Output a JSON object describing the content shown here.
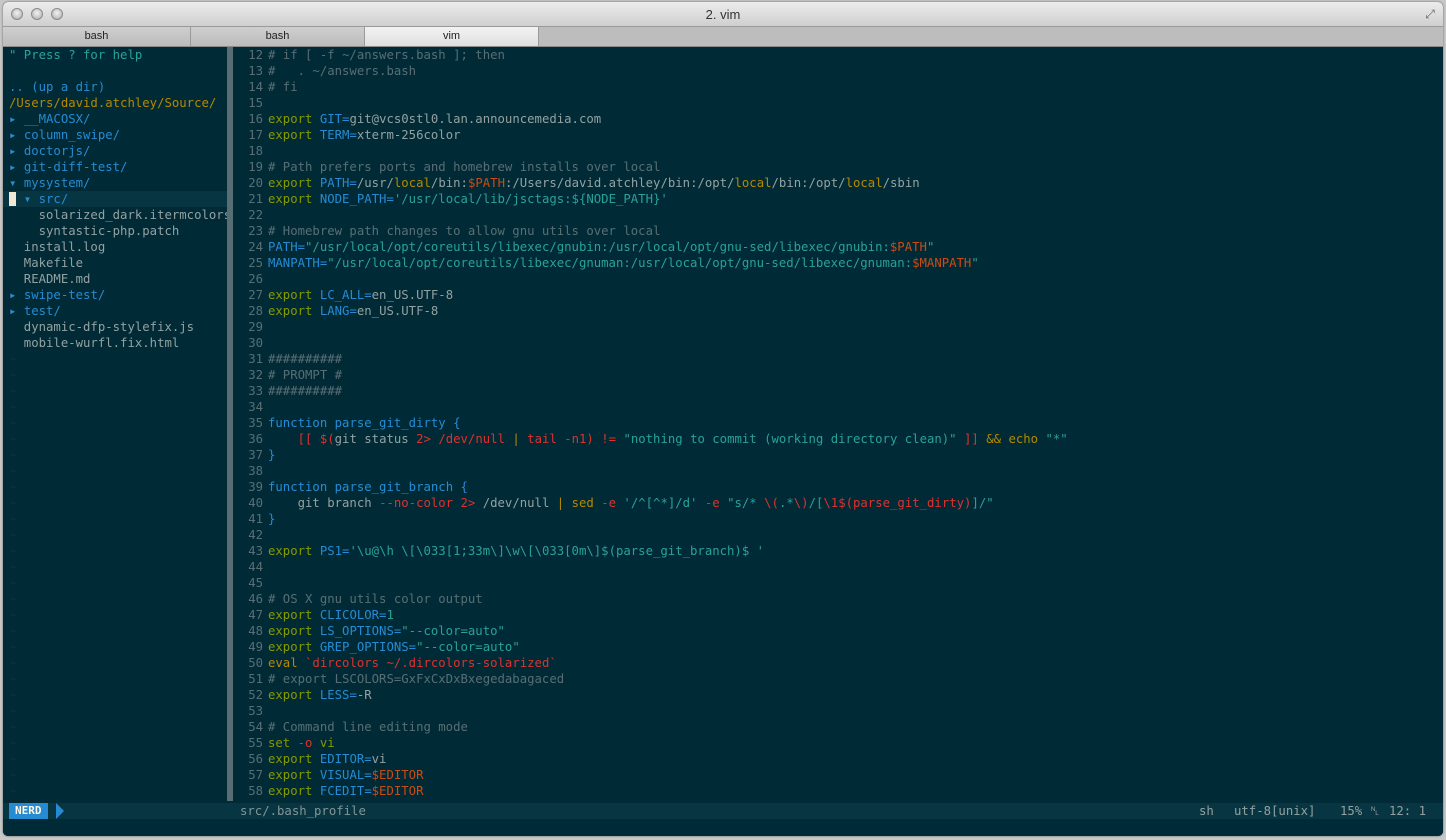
{
  "window": {
    "title": "2. vim"
  },
  "tabs": [
    {
      "label": "bash",
      "active": false
    },
    {
      "label": "bash",
      "active": false
    },
    {
      "label": "vim",
      "active": true
    }
  ],
  "colors": {
    "base03": "#002b36",
    "base02": "#073642",
    "base01": "#586e75",
    "base0": "#839496",
    "base1": "#93a1a1",
    "yellow": "#b58900",
    "orange": "#cb4b16",
    "red": "#dc322f",
    "blue": "#268bd2",
    "cyan": "#2aa198",
    "green": "#859900",
    "violet": "#6c71c4"
  },
  "nerdtree": {
    "lines": [
      [
        {
          "t": "\" Press ? for help",
          "c": "cyan"
        }
      ],
      [
        {
          "t": "",
          "c": "base1"
        }
      ],
      [
        {
          "t": ".. (up a dir)",
          "c": "blue"
        }
      ],
      [
        {
          "t": "/Users/david.atchley/Source/",
          "c": "yellow"
        }
      ],
      [
        {
          "t": "▸ ",
          "c": "blue"
        },
        {
          "t": "__MACOSX/",
          "c": "blue"
        }
      ],
      [
        {
          "t": "▸ ",
          "c": "blue"
        },
        {
          "t": "column_swipe/",
          "c": "blue"
        }
      ],
      [
        {
          "t": "▸ ",
          "c": "blue"
        },
        {
          "t": "doctorjs/",
          "c": "blue"
        }
      ],
      [
        {
          "t": "▸ ",
          "c": "blue"
        },
        {
          "t": "git-diff-test/",
          "c": "blue"
        }
      ],
      [
        {
          "t": "▾ ",
          "c": "blue"
        },
        {
          "t": "mysystem/",
          "c": "blue"
        }
      ],
      [
        {
          "t": "  ▾ ",
          "c": "blue"
        },
        {
          "t": "src/",
          "c": "blue"
        }
      ],
      [
        {
          "t": "    solarized_dark.itermcolors",
          "c": "base1"
        }
      ],
      [
        {
          "t": "    syntastic-php.patch",
          "c": "base1"
        }
      ],
      [
        {
          "t": "  install.log",
          "c": "base1"
        }
      ],
      [
        {
          "t": "  Makefile",
          "c": "base1"
        }
      ],
      [
        {
          "t": "  README.md",
          "c": "base1"
        }
      ],
      [
        {
          "t": "▸ ",
          "c": "blue"
        },
        {
          "t": "swipe-test/",
          "c": "blue"
        }
      ],
      [
        {
          "t": "▸ ",
          "c": "blue"
        },
        {
          "t": "test/",
          "c": "blue"
        }
      ],
      [
        {
          "t": "  dynamic-dfp-stylefix.js",
          "c": "base1"
        }
      ],
      [
        {
          "t": "  mobile-wurfl.fix.html",
          "c": "base1"
        }
      ]
    ],
    "cursor_line": 9,
    "filler": "~"
  },
  "editor": {
    "lines": [
      {
        "n": "12",
        "s": [
          {
            "t": "# if [ -f ~/answers.bash ]; then",
            "c": "base01"
          }
        ]
      },
      {
        "n": "13",
        "s": [
          {
            "t": "#   . ~/answers.bash",
            "c": "base01"
          }
        ]
      },
      {
        "n": "14",
        "s": [
          {
            "t": "# fi",
            "c": "base01"
          }
        ]
      },
      {
        "n": "15",
        "s": []
      },
      {
        "n": "16",
        "s": [
          {
            "t": "export ",
            "c": "green"
          },
          {
            "t": "GIT=",
            "c": "blue"
          },
          {
            "t": "git@vcs0stl0.lan.announcemedia.com",
            "c": "base1"
          }
        ]
      },
      {
        "n": "17",
        "s": [
          {
            "t": "export ",
            "c": "green"
          },
          {
            "t": "TERM=",
            "c": "blue"
          },
          {
            "t": "xterm-256color",
            "c": "base1"
          }
        ]
      },
      {
        "n": "18",
        "s": []
      },
      {
        "n": "19",
        "s": [
          {
            "t": "# Path prefers ports and homebrew installs over local",
            "c": "base01"
          }
        ]
      },
      {
        "n": "20",
        "s": [
          {
            "t": "export ",
            "c": "green"
          },
          {
            "t": "PATH=",
            "c": "blue"
          },
          {
            "t": "/usr/",
            "c": "base1"
          },
          {
            "t": "local",
            "c": "yellow"
          },
          {
            "t": "/bin:",
            "c": "base1"
          },
          {
            "t": "$PATH",
            "c": "orange"
          },
          {
            "t": ":/Users/david.atchley/bin:/opt/",
            "c": "base1"
          },
          {
            "t": "local",
            "c": "yellow"
          },
          {
            "t": "/bin:/opt/",
            "c": "base1"
          },
          {
            "t": "local",
            "c": "yellow"
          },
          {
            "t": "/sbin",
            "c": "base1"
          }
        ]
      },
      {
        "n": "21",
        "s": [
          {
            "t": "export ",
            "c": "green"
          },
          {
            "t": "NODE_PATH=",
            "c": "blue"
          },
          {
            "t": "'/usr/local/lib/jsctags:${NODE_PATH}'",
            "c": "cyan"
          }
        ]
      },
      {
        "n": "22",
        "s": []
      },
      {
        "n": "23",
        "s": [
          {
            "t": "# Homebrew path changes to allow gnu utils over local",
            "c": "base01"
          }
        ]
      },
      {
        "n": "24",
        "s": [
          {
            "t": "PATH=",
            "c": "blue"
          },
          {
            "t": "\"/usr/local/opt/coreutils/libexec/gnubin:/usr/local/opt/gnu-sed/libexec/gnubin:",
            "c": "cyan"
          },
          {
            "t": "$PATH",
            "c": "orange"
          },
          {
            "t": "\"",
            "c": "cyan"
          }
        ]
      },
      {
        "n": "25",
        "s": [
          {
            "t": "MANPATH=",
            "c": "blue"
          },
          {
            "t": "\"/usr/local/opt/coreutils/libexec/gnuman:/usr/local/opt/gnu-sed/libexec/gnuman:",
            "c": "cyan"
          },
          {
            "t": "$MANPATH",
            "c": "orange"
          },
          {
            "t": "\"",
            "c": "cyan"
          }
        ]
      },
      {
        "n": "26",
        "s": []
      },
      {
        "n": "27",
        "s": [
          {
            "t": "export ",
            "c": "green"
          },
          {
            "t": "LC_ALL=",
            "c": "blue"
          },
          {
            "t": "en_US.UTF-8",
            "c": "base1"
          }
        ]
      },
      {
        "n": "28",
        "s": [
          {
            "t": "export ",
            "c": "green"
          },
          {
            "t": "LANG=",
            "c": "blue"
          },
          {
            "t": "en_US.UTF-8",
            "c": "base1"
          }
        ]
      },
      {
        "n": "29",
        "s": []
      },
      {
        "n": "30",
        "s": []
      },
      {
        "n": "31",
        "s": [
          {
            "t": "##########",
            "c": "base01"
          }
        ]
      },
      {
        "n": "32",
        "s": [
          {
            "t": "# PROMPT #",
            "c": "base01"
          }
        ]
      },
      {
        "n": "33",
        "s": [
          {
            "t": "##########",
            "c": "base01"
          }
        ]
      },
      {
        "n": "34",
        "s": []
      },
      {
        "n": "35",
        "s": [
          {
            "t": "function ",
            "c": "blue"
          },
          {
            "t": "parse_git_dirty ",
            "c": "blue"
          },
          {
            "t": "{",
            "c": "blue"
          }
        ]
      },
      {
        "n": "36",
        "s": [
          {
            "t": "    ",
            "c": "base0"
          },
          {
            "t": "[[ ",
            "c": "red"
          },
          {
            "t": "$(",
            "c": "red"
          },
          {
            "t": "git status ",
            "c": "base1"
          },
          {
            "t": "2> ",
            "c": "red"
          },
          {
            "t": "/dev/null ",
            "c": "red"
          },
          {
            "t": "| ",
            "c": "yellow"
          },
          {
            "t": "tail -n1",
            "c": "red"
          },
          {
            "t": ") ",
            "c": "red"
          },
          {
            "t": "!= ",
            "c": "red"
          },
          {
            "t": "\"nothing to commit (working directory clean)\"",
            "c": "cyan"
          },
          {
            "t": " ]] ",
            "c": "red"
          },
          {
            "t": "&& ",
            "c": "yellow"
          },
          {
            "t": "echo ",
            "c": "yellow"
          },
          {
            "t": "\"*\"",
            "c": "cyan"
          }
        ]
      },
      {
        "n": "37",
        "s": [
          {
            "t": "}",
            "c": "blue"
          }
        ]
      },
      {
        "n": "38",
        "s": []
      },
      {
        "n": "39",
        "s": [
          {
            "t": "function ",
            "c": "blue"
          },
          {
            "t": "parse_git_branch ",
            "c": "blue"
          },
          {
            "t": "{",
            "c": "blue"
          }
        ]
      },
      {
        "n": "40",
        "s": [
          {
            "t": "    git branch ",
            "c": "base1"
          },
          {
            "t": "--no-color ",
            "c": "red"
          },
          {
            "t": "2> ",
            "c": "red"
          },
          {
            "t": "/dev/null ",
            "c": "base1"
          },
          {
            "t": "| ",
            "c": "yellow"
          },
          {
            "t": "sed ",
            "c": "yellow"
          },
          {
            "t": "-e ",
            "c": "red"
          },
          {
            "t": "'/^[^*]/d'",
            "c": "cyan"
          },
          {
            "t": " -e ",
            "c": "red"
          },
          {
            "t": "\"s/* ",
            "c": "cyan"
          },
          {
            "t": "\\(",
            "c": "red"
          },
          {
            "t": ".*",
            "c": "cyan"
          },
          {
            "t": "\\)",
            "c": "red"
          },
          {
            "t": "/[",
            "c": "cyan"
          },
          {
            "t": "\\1",
            "c": "red"
          },
          {
            "t": "$(parse_git_dirty)",
            "c": "red"
          },
          {
            "t": "]/\"",
            "c": "cyan"
          }
        ]
      },
      {
        "n": "41",
        "s": [
          {
            "t": "}",
            "c": "blue"
          }
        ]
      },
      {
        "n": "42",
        "s": []
      },
      {
        "n": "43",
        "s": [
          {
            "t": "export ",
            "c": "green"
          },
          {
            "t": "PS1=",
            "c": "blue"
          },
          {
            "t": "'\\u@\\h \\[\\033[1;33m\\]\\w\\[\\033[0m\\]$(parse_git_branch)$ '",
            "c": "cyan"
          }
        ]
      },
      {
        "n": "44",
        "s": []
      },
      {
        "n": "45",
        "s": []
      },
      {
        "n": "46",
        "s": [
          {
            "t": "# OS X gnu utils color output",
            "c": "base01"
          }
        ]
      },
      {
        "n": "47",
        "s": [
          {
            "t": "export ",
            "c": "green"
          },
          {
            "t": "CLICOLOR=",
            "c": "blue"
          },
          {
            "t": "1",
            "c": "cyan"
          }
        ]
      },
      {
        "n": "48",
        "s": [
          {
            "t": "export ",
            "c": "green"
          },
          {
            "t": "LS_OPTIONS=",
            "c": "blue"
          },
          {
            "t": "\"--color=auto\"",
            "c": "cyan"
          }
        ]
      },
      {
        "n": "49",
        "s": [
          {
            "t": "export ",
            "c": "green"
          },
          {
            "t": "GREP_OPTIONS=",
            "c": "blue"
          },
          {
            "t": "\"--color=auto\"",
            "c": "cyan"
          }
        ]
      },
      {
        "n": "50",
        "s": [
          {
            "t": "eval ",
            "c": "yellow"
          },
          {
            "t": "`dircolors ~/.dircolors-solarized`",
            "c": "red"
          }
        ]
      },
      {
        "n": "51",
        "s": [
          {
            "t": "# export LSCOLORS=GxFxCxDxBxegedabagaced",
            "c": "base01"
          }
        ]
      },
      {
        "n": "52",
        "s": [
          {
            "t": "export ",
            "c": "green"
          },
          {
            "t": "LESS=",
            "c": "blue"
          },
          {
            "t": "-R",
            "c": "base1"
          }
        ]
      },
      {
        "n": "53",
        "s": []
      },
      {
        "n": "54",
        "s": [
          {
            "t": "# Command line editing mode",
            "c": "base01"
          }
        ]
      },
      {
        "n": "55",
        "s": [
          {
            "t": "set ",
            "c": "green"
          },
          {
            "t": "-o ",
            "c": "red"
          },
          {
            "t": "vi",
            "c": "green"
          }
        ]
      },
      {
        "n": "56",
        "s": [
          {
            "t": "export ",
            "c": "green"
          },
          {
            "t": "EDITOR=",
            "c": "blue"
          },
          {
            "t": "vi",
            "c": "base1"
          }
        ]
      },
      {
        "n": "57",
        "s": [
          {
            "t": "export ",
            "c": "green"
          },
          {
            "t": "VISUAL=",
            "c": "blue"
          },
          {
            "t": "$EDITOR",
            "c": "orange"
          }
        ]
      },
      {
        "n": "58",
        "s": [
          {
            "t": "export ",
            "c": "green"
          },
          {
            "t": "FCEDIT=",
            "c": "blue"
          },
          {
            "t": "$EDITOR",
            "c": "orange"
          }
        ]
      }
    ]
  },
  "statusline": {
    "mode": "NERD",
    "file": "src/.bash_profile",
    "filetype": "sh",
    "encoding": "utf-8[unix]",
    "percent": "15%",
    "position": "12:  1"
  }
}
